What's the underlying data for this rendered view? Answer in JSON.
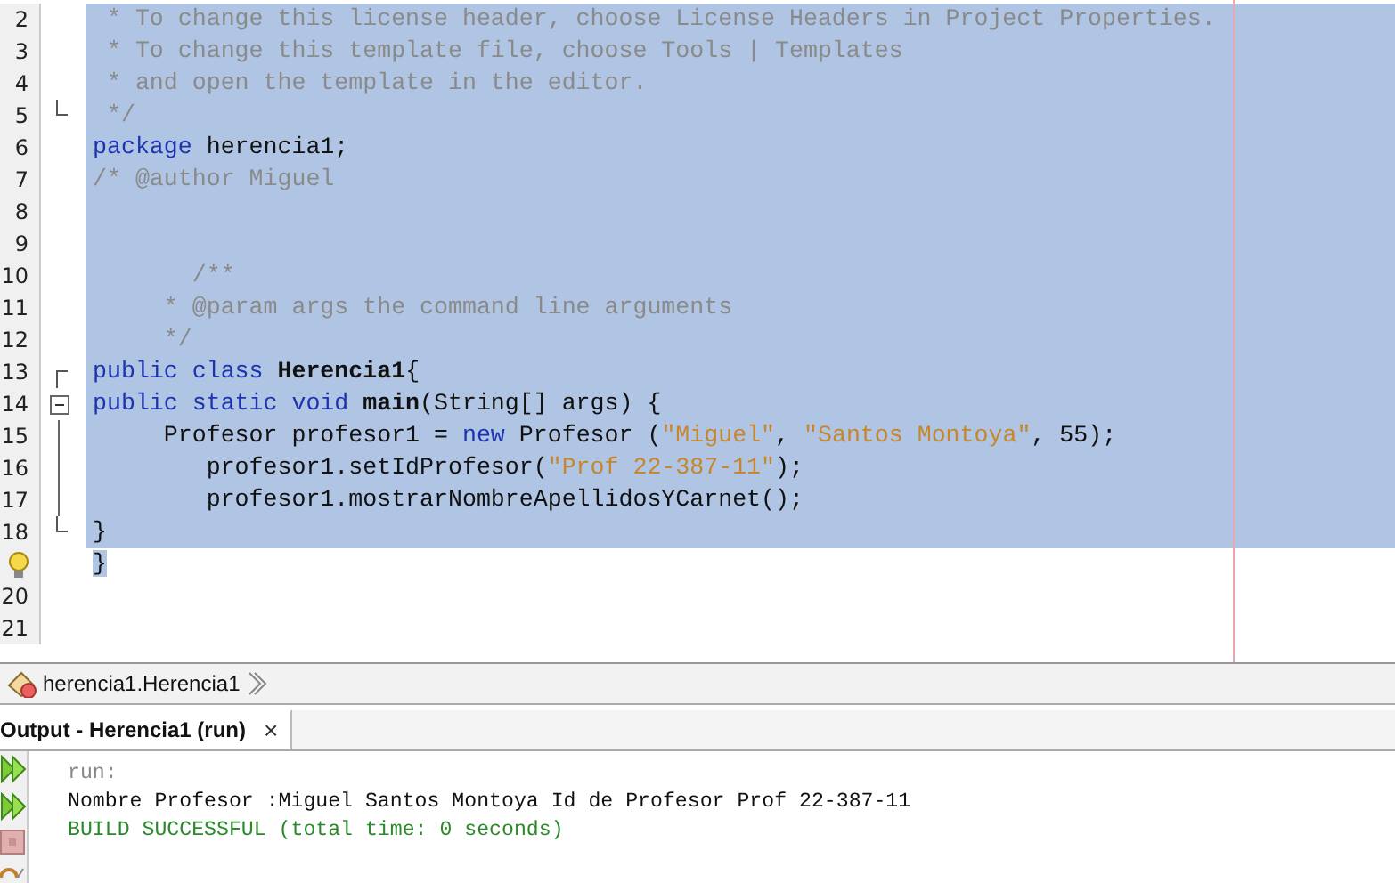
{
  "editor": {
    "lines": [
      {
        "number": "2",
        "selected": true,
        "segments": [
          {
            "kind": "comment",
            "text": " * To change this license header, choose License Headers in Project Properties."
          }
        ]
      },
      {
        "number": "3",
        "selected": true,
        "segments": [
          {
            "kind": "comment",
            "text": " * To change this template file, choose Tools | Templates"
          }
        ]
      },
      {
        "number": "4",
        "selected": true,
        "segments": [
          {
            "kind": "comment",
            "text": " * and open the template in the editor."
          }
        ]
      },
      {
        "number": "5",
        "selected": true,
        "fold_end": true,
        "segments": [
          {
            "kind": "comment",
            "text": " */"
          }
        ]
      },
      {
        "number": "6",
        "selected": true,
        "segments": [
          {
            "kind": "keyword",
            "text": "package"
          },
          {
            "kind": "plain",
            "text": " herencia1;"
          }
        ]
      },
      {
        "number": "7",
        "selected": true,
        "segments": [
          {
            "kind": "comment",
            "text": "/* @author Miguel"
          }
        ]
      },
      {
        "number": "8",
        "selected": true
      },
      {
        "number": "9",
        "selected": true
      },
      {
        "number": "10",
        "selected": true,
        "segments": [
          {
            "kind": "comment",
            "text": "       /**"
          }
        ]
      },
      {
        "number": "11",
        "selected": true,
        "segments": [
          {
            "kind": "comment",
            "text": "     * @param args the command line arguments"
          }
        ]
      },
      {
        "number": "12",
        "selected": true,
        "segments": [
          {
            "kind": "comment",
            "text": "     */"
          }
        ]
      },
      {
        "number": "13",
        "selected": true,
        "fold_start": true,
        "segments": [
          {
            "kind": "keyword",
            "text": "public class "
          },
          {
            "kind": "bold",
            "text": "Herencia1"
          },
          {
            "kind": "plain",
            "text": "{"
          }
        ]
      },
      {
        "number": "14",
        "selected": true,
        "fold_toggle": true,
        "segments": [
          {
            "kind": "keyword",
            "text": "public static void "
          },
          {
            "kind": "bold",
            "text": "main"
          },
          {
            "kind": "plain",
            "text": "(String[] args) {"
          }
        ]
      },
      {
        "number": "15",
        "selected": true,
        "in_fold": true,
        "segments": [
          {
            "kind": "plain",
            "text": "     Profesor profesor1 = "
          },
          {
            "kind": "keyword",
            "text": "new"
          },
          {
            "kind": "plain",
            "text": " Profesor ("
          },
          {
            "kind": "string",
            "text": "\"Miguel\""
          },
          {
            "kind": "plain",
            "text": ", "
          },
          {
            "kind": "string",
            "text": "\"Santos Montoya\""
          },
          {
            "kind": "plain",
            "text": ", 55);"
          }
        ]
      },
      {
        "number": "16",
        "selected": true,
        "in_fold": true,
        "segments": [
          {
            "kind": "plain",
            "text": "        profesor1.setIdProfesor("
          },
          {
            "kind": "string",
            "text": "\"Prof 22-387-11\""
          },
          {
            "kind": "plain",
            "text": ");"
          }
        ]
      },
      {
        "number": "17",
        "selected": true,
        "in_fold": true,
        "segments": [
          {
            "kind": "plain",
            "text": "        profesor1.mostrarNombreApellidosYCarnet();"
          }
        ]
      },
      {
        "number": "18",
        "selected": true,
        "fold_end": true,
        "segments": [
          {
            "kind": "plain",
            "text": "}"
          }
        ]
      },
      {
        "selected": true,
        "selection_ends": true,
        "hint": true,
        "segments": [
          {
            "kind": "plain",
            "text": "}"
          }
        ]
      },
      {
        "number": "20",
        "selected": false
      },
      {
        "number": "21",
        "selected": false
      }
    ]
  },
  "breadcrumb": {
    "text": "herencia1.Herencia1"
  },
  "output": {
    "tab": {
      "label": "Output - Herencia1 (run)",
      "close": "×"
    },
    "lines": [
      {
        "kind": "muted",
        "text": "run:"
      },
      {
        "kind": "plain",
        "text": "Nombre Profesor :Miguel Santos Montoya Id de Profesor Prof 22-387-11"
      },
      {
        "kind": "success",
        "text": "BUILD SUCCESSFUL (total time: 0 seconds)"
      }
    ]
  }
}
